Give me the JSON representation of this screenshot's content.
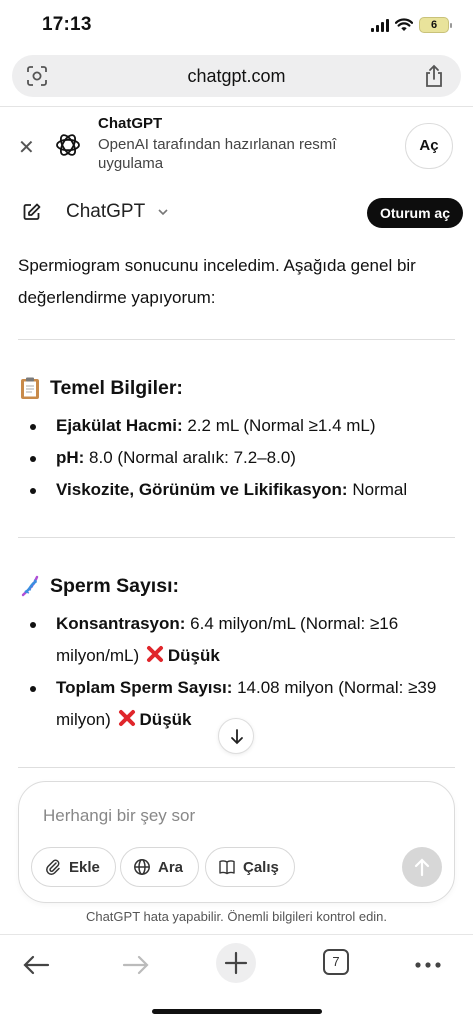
{
  "status_bar": {
    "time": "17:13",
    "battery": "6"
  },
  "browser": {
    "url": "chatgpt.com",
    "tab_count": "7"
  },
  "app_banner": {
    "title": "ChatGPT",
    "subtitle": "OpenAI tarafından hazırlanan resmî uygulama",
    "open_label": "Aç"
  },
  "chat_header": {
    "model_name": "ChatGPT",
    "login_label": "Oturum aç"
  },
  "message": {
    "intro": "Spermiogram sonucunu inceledim. Aşağıda genel bir değerlendirme yapıyorum:",
    "sections": [
      {
        "icon": "clipboard-icon",
        "title": "Temel Bilgiler:",
        "items": [
          {
            "label": "Ejakülat Hacmi:",
            "text": " 2.2 mL (Normal ≥1.4 mL)"
          },
          {
            "label": "pH:",
            "text": " 8.0 (Normal aralık: 7.2–8.0)"
          },
          {
            "label": "Viskozite, Görünüm ve Likifikasyon:",
            "text": " Normal"
          }
        ]
      },
      {
        "icon": "dna-icon",
        "title": "Sperm Sayısı:",
        "items": [
          {
            "label": "Konsantrasyon:",
            "text": " 6.4 milyon/mL (Normal: ≥16 milyon/mL)",
            "flag": "Düşük"
          },
          {
            "label": "Toplam Sperm Sayısı:",
            "text": " 14.08 milyon (Normal: ≥39 milyon)",
            "flag": "Düşük"
          }
        ]
      }
    ]
  },
  "composer": {
    "placeholder": "Herhangi bir şey sor",
    "attach_label": "Ekle",
    "search_label": "Ara",
    "study_label": "Çalış"
  },
  "disclaimer": "ChatGPT hata yapabilir. Önemli bilgileri kontrol edin.",
  "colors": {
    "login_bg": "#0d0d0d",
    "flag_red": "#e0262b",
    "send_disabled": "#d7d7d7"
  }
}
